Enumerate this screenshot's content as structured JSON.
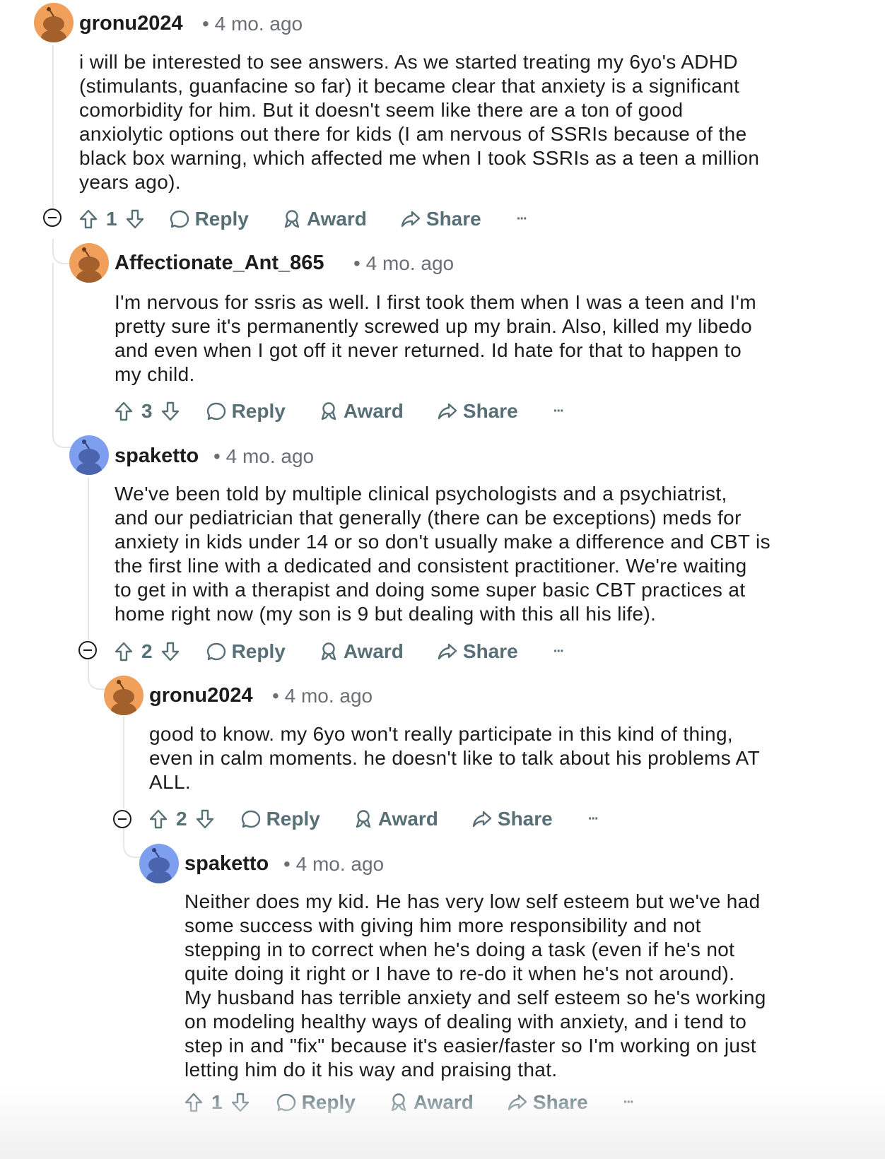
{
  "comments": [
    {
      "username": "gronu2024",
      "time": "4 mo. ago",
      "avatar": "orange",
      "body": "i will be interested to see answers. As we started treating my 6yo's ADHD\n(stimulants, guanfacine so far) it became clear that anxiety is a significant\ncomorbidity for him. But it doesn't seem like there are a ton of good\nanxiolytic options out there for kids (I am nervous of SSRIs because of the\nblack box warning, which affected me when I took SSRIs as a teen a million\nyears ago).",
      "votes": "1",
      "reply": "Reply",
      "award": "Award",
      "share": "Share",
      "more": "···"
    },
    {
      "username": "Affectionate_Ant_865",
      "time": "4 mo. ago",
      "avatar": "orange",
      "body": "I'm nervous for ssris as well. I first took them when I was a teen and I'm\npretty sure it's permanently screwed up my brain. Also, killed my libedo\nand even when I got off it never returned. Id hate for that to happen to\nmy child.",
      "votes": "3",
      "reply": "Reply",
      "award": "Award",
      "share": "Share",
      "more": "···"
    },
    {
      "username": "spaketto",
      "time": "4 mo. ago",
      "avatar": "blue",
      "body": "We've been told by multiple clinical psychologists and a psychiatrist,\nand our pediatrician that generally (there can be exceptions) meds for\nanxiety in kids under 14 or so don't usually make a difference and CBT is\nthe first line with a dedicated and consistent practitioner.  We're waiting\nto get in with a therapist and doing some super basic CBT practices at\nhome right now (my son is 9 but dealing with this all his life).",
      "votes": "2",
      "reply": "Reply",
      "award": "Award",
      "share": "Share",
      "more": "···"
    },
    {
      "username": "gronu2024",
      "time": "4 mo. ago",
      "avatar": "orange",
      "body": "good to know. my 6yo won't really participate in this kind of thing,\neven in calm moments. he doesn't like to talk about his problems AT\nALL.",
      "votes": "2",
      "reply": "Reply",
      "award": "Award",
      "share": "Share",
      "more": "···"
    },
    {
      "username": "spaketto",
      "time": "4 mo. ago",
      "avatar": "blue",
      "body": "Neither does my kid.  He has very low self esteem but we've had\nsome success with giving him more responsibility and not\nstepping in to correct when he's doing a task (even if he's not\nquite doing it right or I have to re-do it when he's not around).\nMy husband has terrible anxiety and self esteem so he's working\non modeling healthy ways of dealing with anxiety, and i tend to\nstep in and \"fix\" because it's easier/faster so I'm working on just\nletting him do it his way and praising that.",
      "votes": "1",
      "reply": "Reply",
      "award": "Award",
      "share": "Share",
      "more": "···"
    }
  ],
  "separator": "•",
  "colors": {
    "avatar_orange": "#f0a05a",
    "avatar_blue": "#7e9ef0",
    "action_text": "#576f76",
    "thread_line": "#e4e6e8"
  },
  "icons": [
    "upvote-icon",
    "downvote-icon",
    "comment-icon",
    "award-icon",
    "share-icon",
    "collapse-icon",
    "snoo-avatar-icon"
  ]
}
